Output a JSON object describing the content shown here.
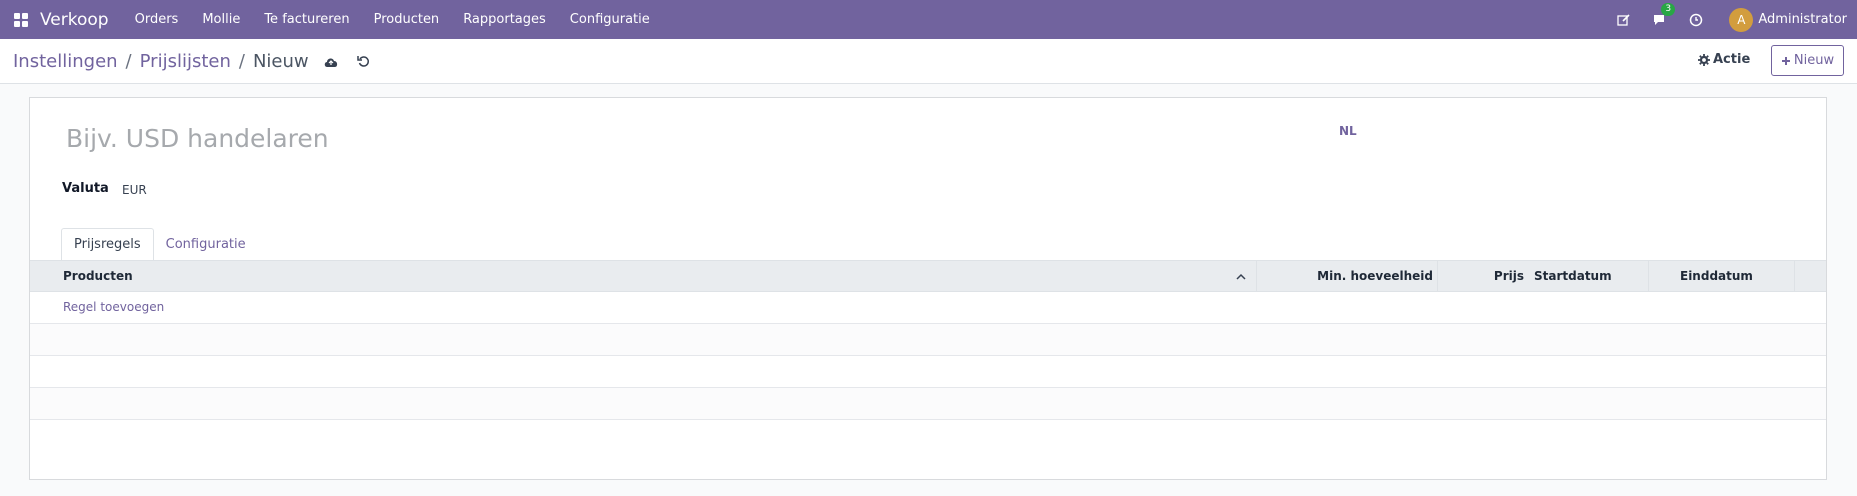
{
  "navbar": {
    "brand": "Verkoop",
    "menu": [
      "Orders",
      "Mollie",
      "Te factureren",
      "Producten",
      "Rapportages",
      "Configuratie"
    ],
    "messages_count": "3",
    "avatar_initial": "A",
    "user": "Administrator"
  },
  "breadcrumb": {
    "level1": "Instellingen",
    "level2": "Prijslijsten",
    "current": "Nieuw",
    "sep": "/"
  },
  "actions": {
    "action_label": "Actie",
    "new_label": "Nieuw"
  },
  "form": {
    "name_placeholder": "Bijv. USD handelaren",
    "lang": "NL",
    "currency_label": "Valuta",
    "currency_value": "EUR"
  },
  "tabs": [
    "Prijsregels",
    "Configuratie"
  ],
  "table": {
    "columns": {
      "products": "Producten",
      "min_qty": "Min. hoeveelheid",
      "price": "Prijs",
      "start": "Startdatum",
      "end": "Einddatum"
    },
    "add_line": "Regel toevoegen"
  },
  "colors": {
    "brand": "#71639e",
    "badge": "#28a745",
    "avatar": "#d29d3e"
  }
}
